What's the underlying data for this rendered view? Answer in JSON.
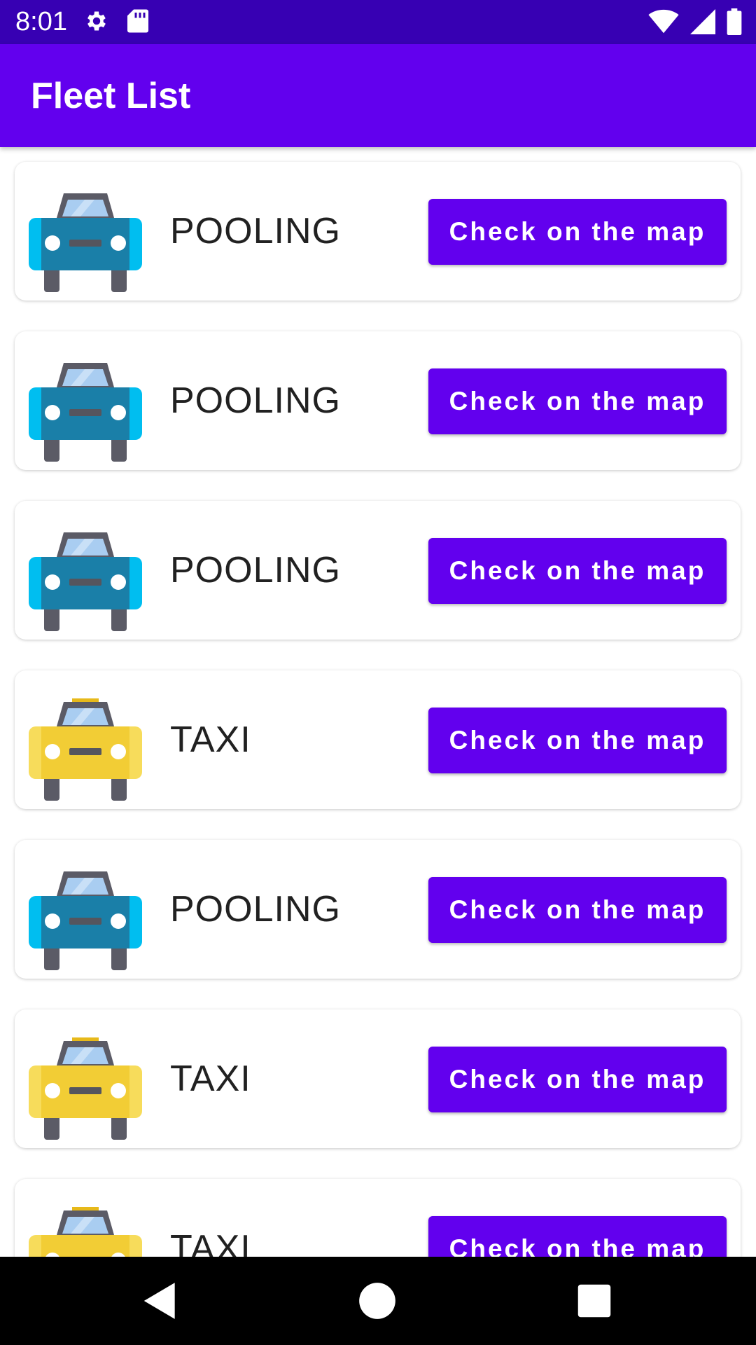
{
  "status_bar": {
    "time": "8:01",
    "left_icons": [
      "settings-icon",
      "sd-card-icon"
    ],
    "right_icons": [
      "wifi-icon",
      "signal-icon",
      "battery-icon"
    ]
  },
  "app_bar": {
    "title": "Fleet List"
  },
  "colors": {
    "primary": "#6200ee",
    "primary_dark": "#3700b3",
    "pooling_car": "#1a7fa8",
    "taxi_car": "#f2cd35"
  },
  "vehicles": [
    {
      "type": "POOLING",
      "icon": "pooling-car-icon",
      "button_label": "Check on the map"
    },
    {
      "type": "POOLING",
      "icon": "pooling-car-icon",
      "button_label": "Check on the map"
    },
    {
      "type": "POOLING",
      "icon": "pooling-car-icon",
      "button_label": "Check on the map"
    },
    {
      "type": "TAXI",
      "icon": "taxi-icon",
      "button_label": "Check on the map"
    },
    {
      "type": "POOLING",
      "icon": "pooling-car-icon",
      "button_label": "Check on the map"
    },
    {
      "type": "TAXI",
      "icon": "taxi-icon",
      "button_label": "Check on the map"
    },
    {
      "type": "TAXI",
      "icon": "taxi-icon",
      "button_label": "Check on the map"
    }
  ],
  "nav_bar": {
    "icons": [
      "back-icon",
      "home-icon",
      "recents-icon"
    ]
  }
}
